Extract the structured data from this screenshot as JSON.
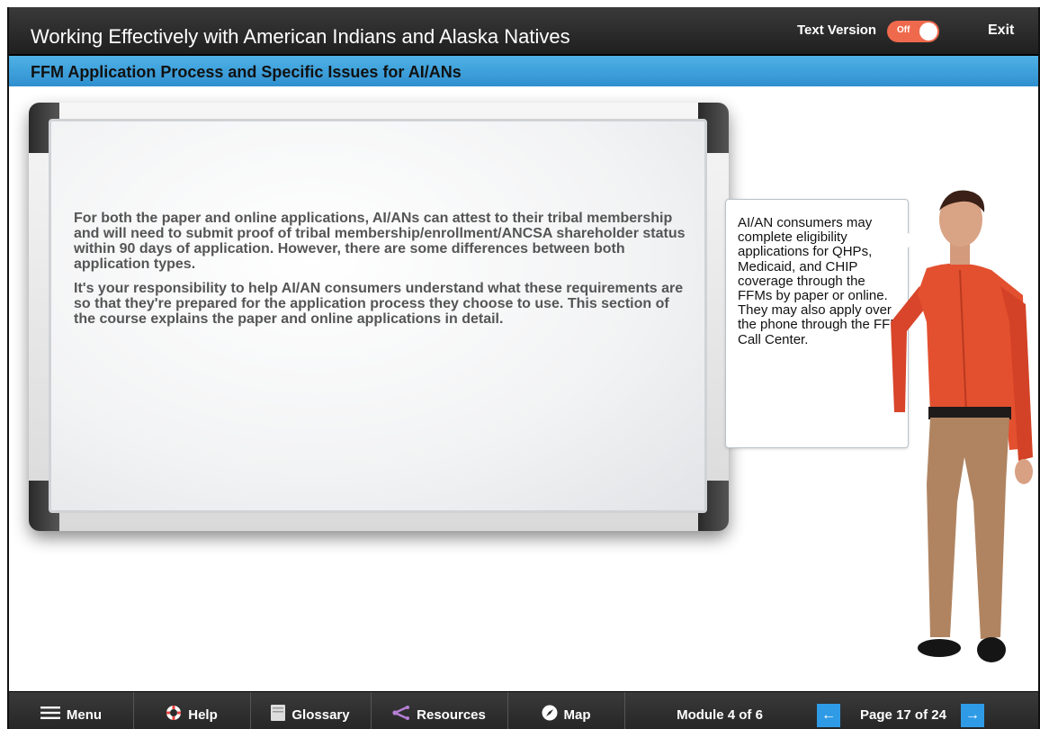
{
  "header": {
    "title": "Working Effectively with American Indians and Alaska Natives",
    "text_version_label": "Text Version",
    "toggle_state": "Off",
    "exit_label": "Exit"
  },
  "section": {
    "title": "FFM Application Process and Specific Issues for AI/ANs"
  },
  "board": {
    "paragraph_1": "For both the paper and online applications, AI/ANs can attest to their tribal membership and will need to submit proof of tribal membership/enrollment/ANCSA shareholder status within 90 days of application. However, there are some differences between both application types.",
    "paragraph_2": "It's your responsibility to help AI/AN consumers understand what these requirements are so that they're prepared for the application process they choose to use. This section of the course explains the paper and online applications in detail."
  },
  "bubble": {
    "text": "AI/AN consumers may complete eligibility applications for QHPs, Medicaid, and CHIP coverage through the FFMs by paper or online. They may also apply over the phone through the FFM Call Center."
  },
  "footer": {
    "menu_label": "Menu",
    "help_label": "Help",
    "glossary_label": "Glossary",
    "resources_label": "Resources",
    "map_label": "Map",
    "module_label": "Module 4 of 6",
    "page_label": "Page 17 of 24",
    "prev_icon": "arrow-left-icon",
    "next_icon": "arrow-right-icon"
  },
  "colors": {
    "accent_blue": "#3aa0dc",
    "toggle_red": "#ef6a4d",
    "dark_bar": "#2b2b2b"
  }
}
